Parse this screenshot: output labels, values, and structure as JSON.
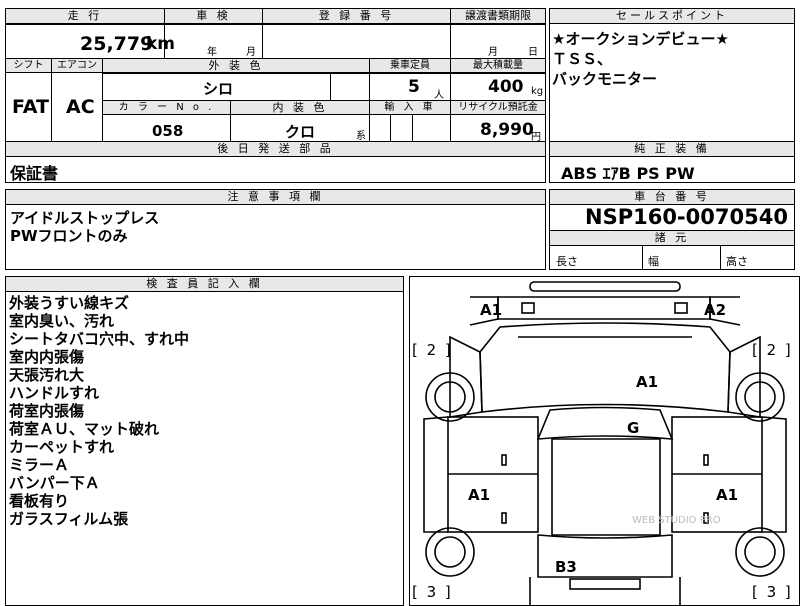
{
  "mileage": {
    "header": "走 行",
    "value": "25,779",
    "unit": "km"
  },
  "inspection": {
    "header": "車 検",
    "year_unit": "年",
    "month_unit": "月"
  },
  "registration": {
    "header": "登 録 番 号"
  },
  "transfer": {
    "header": "譲渡書類期限",
    "month_unit": "月",
    "day_unit": "日"
  },
  "shift": {
    "header": "シフト",
    "value": "FAT"
  },
  "aircon": {
    "header": "エアコン",
    "value": "AC"
  },
  "exterior": {
    "header": "外 装 色",
    "value": "シロ"
  },
  "color_no": {
    "header": "カ ラ ー N o .",
    "value": "058"
  },
  "interior": {
    "header": "内 装 色",
    "value": "クロ",
    "suffix": "系"
  },
  "capacity": {
    "header": "乗車定員",
    "value": "5",
    "unit": "人"
  },
  "max_load": {
    "header": "最大積載量",
    "value": "400",
    "unit": "kg"
  },
  "import": {
    "header": "輸 入 車"
  },
  "recycle": {
    "header": "リサイクル預託金",
    "value": "8,990",
    "unit": "円"
  },
  "later_parts": {
    "header": "後 日 発 送 部 品",
    "value": "保証書"
  },
  "selling_points": {
    "header": "セールスポイント",
    "lines": [
      "★オークションデビュー★",
      "ＴＳＳ、",
      "バックモニター"
    ]
  },
  "standard_equipment": {
    "header": "純 正 装 備",
    "value": "ABS ｴｱB PS PW"
  },
  "notes": {
    "header": "注 意 事 項 欄",
    "lines": [
      "アイドルストップレス",
      "PWフロントのみ"
    ]
  },
  "chassis": {
    "header": "車 台 番 号",
    "value": "NSP160-0070540"
  },
  "dimensions": {
    "header": "諸 元",
    "length": "長さ",
    "width": "幅",
    "height": "高さ"
  },
  "inspector": {
    "header": "検 査 員 記 入 欄",
    "lines": [
      "外装うすい線キズ",
      "室内臭い、汚れ",
      "シートタバコ穴中、すれ中",
      "室内内張傷",
      "天張汚れ大",
      "ハンドルすれ",
      "荷室内張傷",
      "荷室ＡＵ、マット破れ",
      "カーペットすれ",
      "ミラーＡ",
      "バンパー下Ａ",
      "看板有り",
      "ガラスフィルム張"
    ]
  },
  "diagram": {
    "labels": {
      "front_left": "A1",
      "front_right": "A2",
      "hood": "A1",
      "windshield": "G",
      "left_side": "A1",
      "right_side": "A1",
      "rear": "B3"
    },
    "brackets": {
      "left_top": "[ 2 ]",
      "right_top": "[ 2 ]",
      "left_bottom": "[ 3 ]",
      "right_bottom": "[ 3 ]"
    },
    "watermark": "WEB STUDIO PRO"
  }
}
